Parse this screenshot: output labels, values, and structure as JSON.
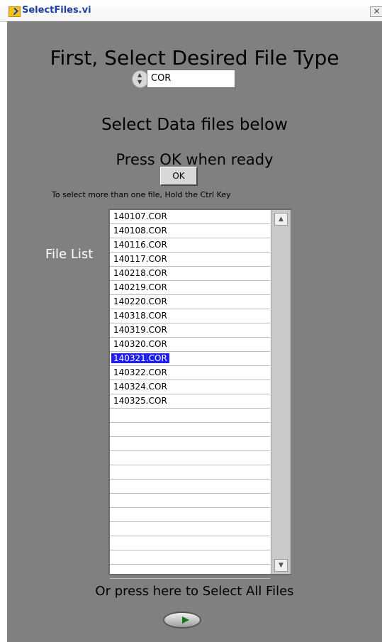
{
  "window": {
    "title": "SelectFiles.vi",
    "close_glyph": "✕",
    "icon": "labview-vi-icon"
  },
  "file_type": {
    "heading": "First, Select Desired File Type",
    "value": "COR",
    "spinner_up": "▲",
    "spinner_down": "▼"
  },
  "data_select": {
    "heading": "Select Data files below",
    "ready_text": "Press OK when ready",
    "ok_label": "OK",
    "hint": "To select more than one file, Hold the Ctrl Key"
  },
  "file_list": {
    "label": "File List",
    "items": [
      "140107.COR",
      "140108.COR",
      "140116.COR",
      "140117.COR",
      "140218.COR",
      "140219.COR",
      "140220.COR",
      "140318.COR",
      "140319.COR",
      "140320.COR",
      "140321.COR",
      "140322.COR",
      "140324.COR",
      "140325.COR"
    ],
    "selected_index": 10,
    "empty_rows": 12,
    "scroll_up": "▲",
    "scroll_down": "▼"
  },
  "select_all": {
    "label": "Or press here to Select All Files"
  },
  "colors": {
    "panel": "#808080",
    "selection": "#2020f0",
    "title_text": "#1b3fa2"
  }
}
